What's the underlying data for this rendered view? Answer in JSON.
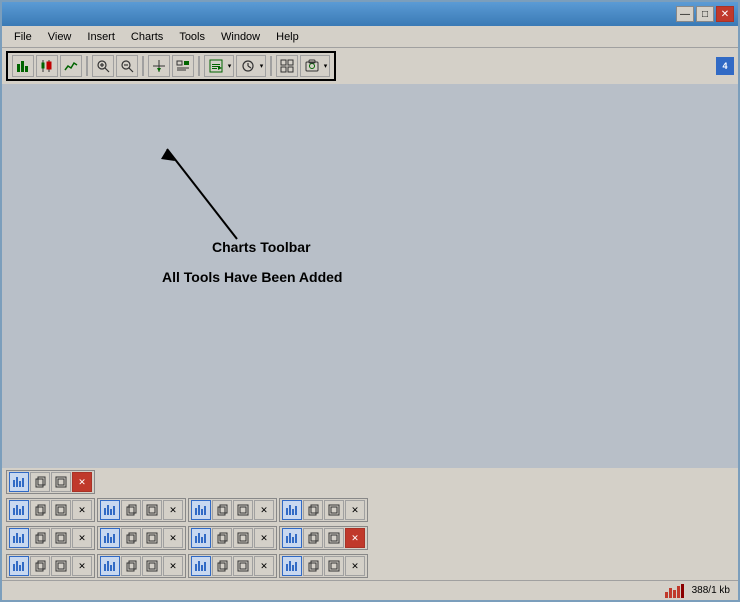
{
  "window": {
    "title": "",
    "titlebar_controls": {
      "minimize": "—",
      "maximize": "□",
      "close": "✕"
    }
  },
  "menubar": {
    "items": [
      "File",
      "View",
      "Insert",
      "Charts",
      "Tools",
      "Window",
      "Help"
    ]
  },
  "toolbar": {
    "badge": "4",
    "buttons": [
      {
        "name": "bar-chart-btn",
        "icon": "bar"
      },
      {
        "name": "candle-btn",
        "icon": "candle"
      },
      {
        "name": "line-chart-btn",
        "icon": "line"
      },
      {
        "name": "zoom-in-btn",
        "icon": "zoom-in"
      },
      {
        "name": "zoom-out-btn",
        "icon": "zoom-out"
      },
      {
        "name": "crosshair-btn",
        "icon": "crosshair"
      },
      {
        "name": "period-btn",
        "icon": "period"
      },
      {
        "name": "template-btn",
        "icon": "template"
      },
      {
        "name": "clock-btn",
        "icon": "clock"
      },
      {
        "name": "grid-btn",
        "icon": "grid"
      },
      {
        "name": "snapshot-btn",
        "icon": "snapshot"
      }
    ]
  },
  "main": {
    "annotation_title": "Charts Toolbar",
    "annotation_subtitle": "All Tools Have Been Added"
  },
  "bottom": {
    "rows": 4
  },
  "statusbar": {
    "info": "388/1 kb"
  }
}
